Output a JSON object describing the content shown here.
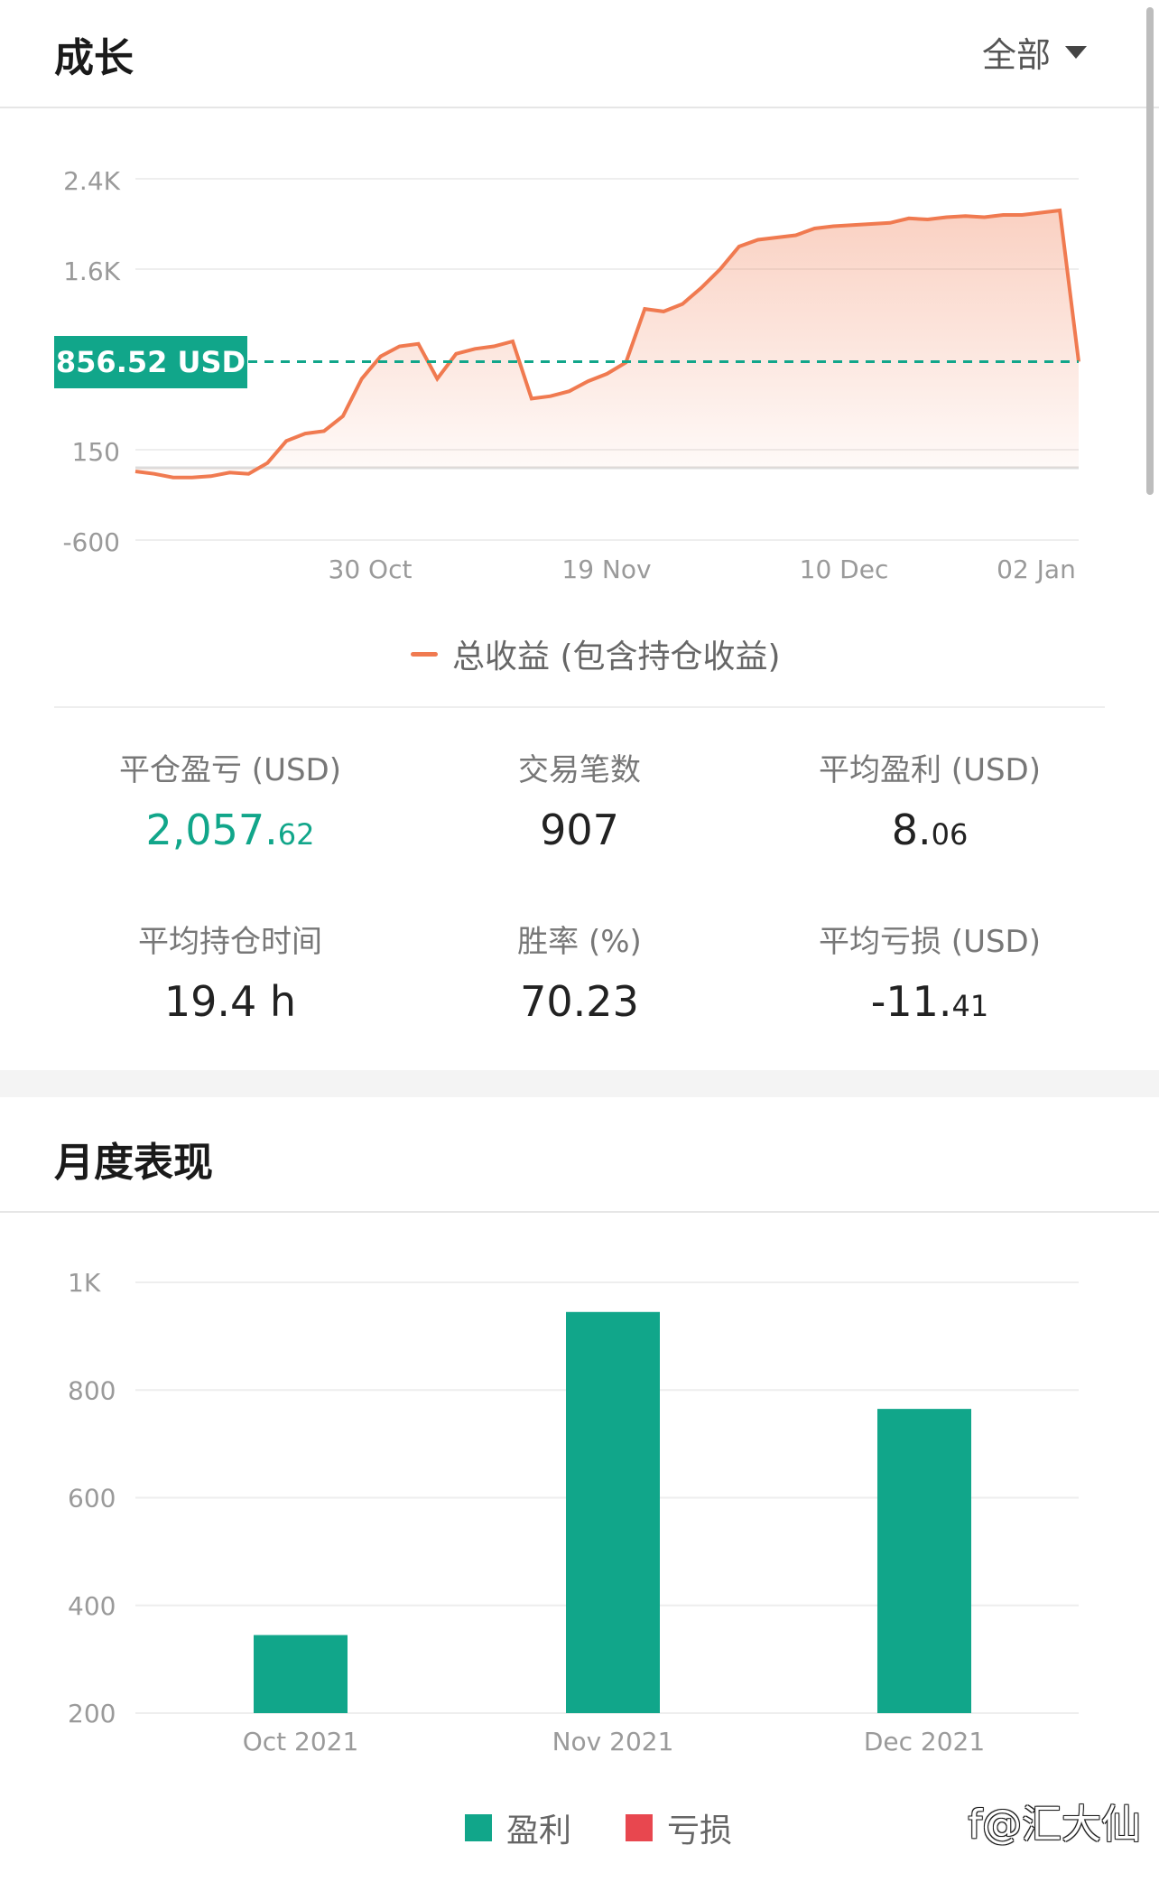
{
  "growth": {
    "title": "成长",
    "filter_label": "全部",
    "current_badge": "856.52 USD",
    "legend": "总收益 (包含持仓收益)"
  },
  "stats": {
    "realized_pnl_label": "平仓盈亏 (USD)",
    "realized_pnl_main": "2,057.",
    "realized_pnl_frac": "62",
    "trades_label": "交易笔数",
    "trades_value": "907",
    "avg_profit_label": "平均盈利 (USD)",
    "avg_profit_main": "8.",
    "avg_profit_frac": "06",
    "avg_hold_label": "平均持仓时间",
    "avg_hold_value": "19.4 h",
    "win_rate_label": "胜率 (%)",
    "win_rate_value": "70.23",
    "avg_loss_label": "平均亏损 (USD)",
    "avg_loss_main": "-11.",
    "avg_loss_frac": "41"
  },
  "monthly": {
    "title": "月度表现",
    "legend_profit": "盈利",
    "legend_loss": "亏损"
  },
  "colors": {
    "accent_green": "#11a68a",
    "line_orange": "#f07a50",
    "loss_red": "#e8474f"
  },
  "watermark": "f@汇大仙",
  "chart_data": [
    {
      "type": "line",
      "title": "",
      "xlabel": "",
      "ylabel": "",
      "x_tick_labels": [
        "30 Oct",
        "19 Nov",
        "10 Dec",
        "02 Jan"
      ],
      "y_tick_labels": [
        "2.4K",
        "1.6K",
        "150",
        "-600"
      ],
      "y_ticks": [
        2400,
        1600,
        150,
        -600
      ],
      "reference_line": 856.52,
      "series": [
        {
          "name": "总收益 (包含持仓收益)",
          "x": [
            0,
            2,
            4,
            6,
            8,
            10,
            12,
            14,
            16,
            18,
            20,
            22,
            24,
            26,
            28,
            30,
            32,
            34,
            36,
            38,
            40,
            42,
            44,
            46,
            48,
            50,
            52,
            54,
            56,
            58,
            60,
            62,
            64,
            66,
            68,
            70,
            72,
            74,
            76,
            78,
            80,
            82,
            84,
            86,
            88,
            90,
            92,
            94,
            96,
            98,
            100
          ],
          "values": [
            -30,
            -50,
            -80,
            -80,
            -70,
            -40,
            -50,
            40,
            220,
            280,
            300,
            420,
            720,
            900,
            980,
            1000,
            720,
            920,
            960,
            980,
            1020,
            560,
            580,
            620,
            700,
            760,
            850,
            1280,
            1260,
            1320,
            1450,
            1600,
            1800,
            1860,
            1880,
            1900,
            1960,
            1980,
            1990,
            2000,
            2010,
            2050,
            2040,
            2060,
            2070,
            2060,
            2080,
            2080,
            2100,
            2120,
            856.52
          ]
        }
      ]
    },
    {
      "type": "bar",
      "title": "",
      "xlabel": "",
      "ylabel": "",
      "categories": [
        "Oct 2021",
        "Nov 2021",
        "Dec 2021"
      ],
      "y_tick_labels": [
        "1K",
        "800",
        "600",
        "400",
        "200"
      ],
      "y_ticks": [
        1000,
        800,
        600,
        400,
        200
      ],
      "ylim": [
        200,
        1000
      ],
      "series": [
        {
          "name": "盈利",
          "values": [
            345,
            945,
            765
          ]
        },
        {
          "name": "亏损",
          "values": [
            0,
            0,
            0
          ]
        }
      ]
    }
  ]
}
